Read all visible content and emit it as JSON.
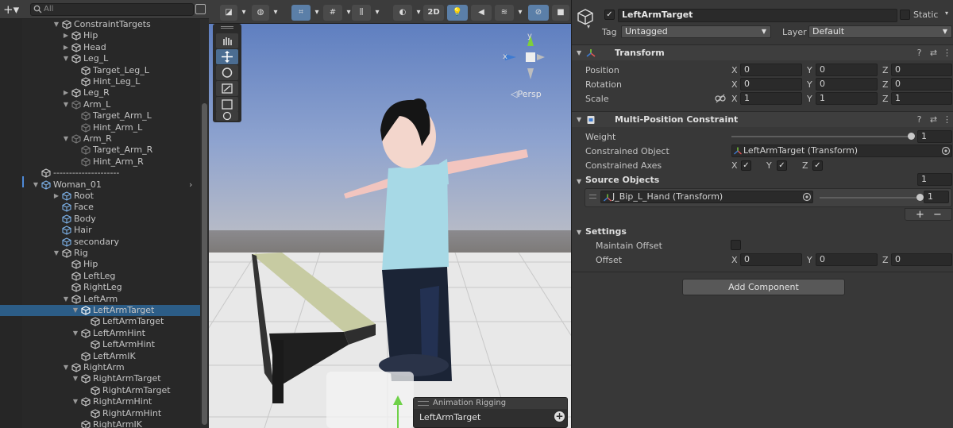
{
  "hierarchy": {
    "add_label": "+▾",
    "search_placeholder": "All",
    "rows": [
      {
        "label": "ConstraintTargets",
        "indent": 0,
        "arrow": "▼",
        "style": ""
      },
      {
        "label": "Hip",
        "indent": 1,
        "arrow": "▶",
        "style": ""
      },
      {
        "label": "Head",
        "indent": 1,
        "arrow": "▶",
        "style": ""
      },
      {
        "label": "Leg_L",
        "indent": 1,
        "arrow": "▼",
        "style": ""
      },
      {
        "label": "Target_Leg_L",
        "indent": 2,
        "arrow": "",
        "style": ""
      },
      {
        "label": "Hint_Leg_L",
        "indent": 2,
        "arrow": "",
        "style": ""
      },
      {
        "label": "Leg_R",
        "indent": 1,
        "arrow": "▶",
        "style": ""
      },
      {
        "label": "Arm_L",
        "indent": 1,
        "arrow": "▼",
        "style": "dim"
      },
      {
        "label": "Target_Arm_L",
        "indent": 2,
        "arrow": "",
        "style": "dim"
      },
      {
        "label": "Hint_Arm_L",
        "indent": 2,
        "arrow": "",
        "style": "dim"
      },
      {
        "label": "Arm_R",
        "indent": 1,
        "arrow": "▼",
        "style": "dim"
      },
      {
        "label": "Target_Arm_R",
        "indent": 2,
        "arrow": "",
        "style": "dim"
      },
      {
        "label": "Hint_Arm_R",
        "indent": 2,
        "arrow": "",
        "style": "dim"
      },
      {
        "label": "---------------------",
        "indent": -1,
        "arrow": "",
        "style": ""
      },
      {
        "label": "Woman_01",
        "indent": -1,
        "arrow": "▼",
        "style": "blue"
      },
      {
        "label": "Root",
        "indent": 0,
        "arrow": "▶",
        "style": "blue"
      },
      {
        "label": "Face",
        "indent": 0,
        "arrow": "",
        "style": "blue"
      },
      {
        "label": "Body",
        "indent": 0,
        "arrow": "",
        "style": "blue"
      },
      {
        "label": "Hair",
        "indent": 0,
        "arrow": "",
        "style": "blue"
      },
      {
        "label": "secondary",
        "indent": 0,
        "arrow": "",
        "style": "blue"
      },
      {
        "label": "Rig",
        "indent": 0,
        "arrow": "▼",
        "style": ""
      },
      {
        "label": "Hip",
        "indent": 1,
        "arrow": "",
        "style": ""
      },
      {
        "label": "LeftLeg",
        "indent": 1,
        "arrow": "",
        "style": ""
      },
      {
        "label": "RightLeg",
        "indent": 1,
        "arrow": "",
        "style": ""
      },
      {
        "label": "LeftArm",
        "indent": 1,
        "arrow": "▼",
        "style": ""
      },
      {
        "label": "LeftArmTarget",
        "indent": 2,
        "arrow": "▼",
        "style": "sel"
      },
      {
        "label": "LeftArmTarget",
        "indent": 3,
        "arrow": "",
        "style": ""
      },
      {
        "label": "LeftArmHint",
        "indent": 2,
        "arrow": "▼",
        "style": ""
      },
      {
        "label": "LeftArmHint",
        "indent": 3,
        "arrow": "",
        "style": ""
      },
      {
        "label": "LeftArmIK",
        "indent": 2,
        "arrow": "",
        "style": ""
      },
      {
        "label": "RightArm",
        "indent": 1,
        "arrow": "▼",
        "style": ""
      },
      {
        "label": "RightArmTarget",
        "indent": 2,
        "arrow": "▼",
        "style": ""
      },
      {
        "label": "RightArmTarget",
        "indent": 3,
        "arrow": "",
        "style": ""
      },
      {
        "label": "RightArmHint",
        "indent": 2,
        "arrow": "▼",
        "style": ""
      },
      {
        "label": "RightArmHint",
        "indent": 3,
        "arrow": "",
        "style": ""
      },
      {
        "label": "RightArmIK",
        "indent": 2,
        "arrow": "",
        "style": ""
      }
    ]
  },
  "scene": {
    "toolbar": {
      "mode_2d": "2D"
    },
    "persp_label": "◁Persp",
    "gizmo": {
      "x": "x",
      "y": "y"
    },
    "overlay": {
      "title": "Animation Rigging",
      "value": "LeftArmTarget"
    }
  },
  "inspector": {
    "object_name": "LeftArmTarget",
    "active": true,
    "static_label": "Static",
    "tag_label": "Tag",
    "tag_value": "Untagged",
    "layer_label": "Layer",
    "layer_value": "Default",
    "transform": {
      "title": "Transform",
      "position_label": "Position",
      "rotation_label": "Rotation",
      "scale_label": "Scale",
      "position": {
        "x": "0",
        "y": "0",
        "z": "0"
      },
      "rotation": {
        "x": "0",
        "y": "0",
        "z": "0"
      },
      "scale": {
        "x": "1",
        "y": "1",
        "z": "1"
      },
      "axis_x": "X",
      "axis_y": "Y",
      "axis_z": "Z"
    },
    "constraint": {
      "title": "Multi-Position Constraint",
      "weight_label": "Weight",
      "weight_value": "1",
      "weight_fraction": 1.0,
      "constrained_object_label": "Constrained Object",
      "constrained_object_value": "LeftArmTarget (Transform)",
      "constrained_axes_label": "Constrained Axes",
      "axes": {
        "x": "X",
        "y": "Y",
        "z": "Z"
      },
      "source_objects_label": "Source Objects",
      "source_count": "1",
      "source_items": [
        {
          "name": "J_Bip_L_Hand (Transform)",
          "weight": "1",
          "weight_fraction": 1.0
        }
      ],
      "add_label": "+",
      "remove_label": "−",
      "settings_label": "Settings",
      "maintain_offset_label": "Maintain Offset",
      "offset_label": "Offset",
      "offset": {
        "x": "0",
        "y": "0",
        "z": "0"
      }
    },
    "add_component_label": "Add Component"
  },
  "colors": {
    "selection": "#2c5d87",
    "prefab_blue": "#7cb1e8",
    "panel_bg": "#383838",
    "hierarchy_bg": "#282828"
  }
}
